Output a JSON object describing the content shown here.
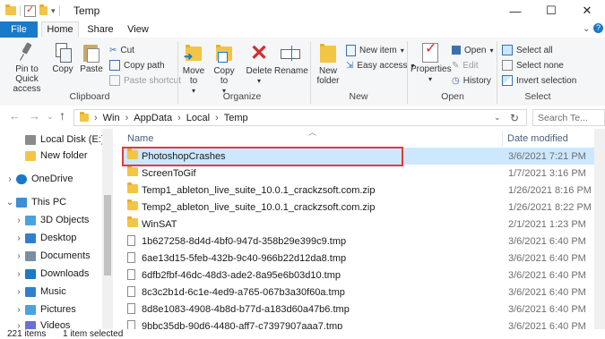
{
  "window": {
    "title": "Temp",
    "minimize": "—",
    "maximize": "☐",
    "close": "✕"
  },
  "tabs": {
    "file": "File",
    "home": "Home",
    "share": "Share",
    "view": "View"
  },
  "ribbon": {
    "clipboard": {
      "pin": "Pin to Quick access",
      "copy": "Copy",
      "paste": "Paste",
      "cut": "Cut",
      "copy_path": "Copy path",
      "paste_shortcut": "Paste shortcut",
      "label": "Clipboard"
    },
    "organize": {
      "move_to": "Move to",
      "copy_to": "Copy to",
      "delete": "Delete",
      "rename": "Rename",
      "label": "Organize"
    },
    "new": {
      "new_folder": "New folder",
      "new_item": "New item",
      "easy_access": "Easy access",
      "label": "New"
    },
    "open": {
      "properties": "Properties",
      "open": "Open",
      "edit": "Edit",
      "history": "History",
      "label": "Open"
    },
    "select": {
      "select_all": "Select all",
      "select_none": "Select none",
      "invert": "Invert selection",
      "label": "Select"
    }
  },
  "address": {
    "path": [
      "Win",
      "AppData",
      "Local",
      "Temp"
    ],
    "search_placeholder": "Search Te..."
  },
  "nav": [
    {
      "label": "Local Disk (E:)",
      "indent": 1,
      "icon": "drive-icon",
      "chevron": ""
    },
    {
      "label": "New folder",
      "indent": 1,
      "icon": "folder-icon",
      "chevron": ""
    },
    {
      "label": "OneDrive",
      "indent": 0,
      "icon": "cloud-icon",
      "chevron": "›"
    },
    {
      "label": "This PC",
      "indent": 0,
      "icon": "pc-icon",
      "chevron": "⌄"
    },
    {
      "label": "3D Objects",
      "indent": 1,
      "icon": "cube-icon",
      "chevron": "›"
    },
    {
      "label": "Desktop",
      "indent": 1,
      "icon": "desktop-icon",
      "chevron": "›"
    },
    {
      "label": "Documents",
      "indent": 1,
      "icon": "documents-icon",
      "chevron": "›"
    },
    {
      "label": "Downloads",
      "indent": 1,
      "icon": "download-icon",
      "chevron": "›"
    },
    {
      "label": "Music",
      "indent": 1,
      "icon": "music-icon",
      "chevron": "›"
    },
    {
      "label": "Pictures",
      "indent": 1,
      "icon": "pictures-icon",
      "chevron": "›"
    },
    {
      "label": "Videos",
      "indent": 1,
      "icon": "videos-icon",
      "chevron": "›"
    }
  ],
  "columns": {
    "name": "Name",
    "date": "Date modified"
  },
  "files": [
    {
      "name": "PhotoshopCrashes",
      "date": "3/6/2021 7:21 PM",
      "type": "folder",
      "selected": true
    },
    {
      "name": "ScreenToGif",
      "date": "1/7/2021 3:16 PM",
      "type": "folder"
    },
    {
      "name": "Temp1_ableton_live_suite_10.0.1_crackzsoft.com.zip",
      "date": "1/26/2021 8:16 PM",
      "type": "folder"
    },
    {
      "name": "Temp2_ableton_live_suite_10.0.1_crackzsoft.com.zip",
      "date": "1/26/2021 8:22 PM",
      "type": "folder"
    },
    {
      "name": "WinSAT",
      "date": "2/1/2021 1:23 PM",
      "type": "folder"
    },
    {
      "name": "1b627258-8d4d-4bf0-947d-358b29e399c9.tmp",
      "date": "3/6/2021 6:40 PM",
      "type": "file"
    },
    {
      "name": "6ae13d15-5feb-432b-9c40-966b22d12da8.tmp",
      "date": "3/6/2021 6:40 PM",
      "type": "file"
    },
    {
      "name": "6dfb2fbf-46dc-48d3-ade2-8a95e6b03d10.tmp",
      "date": "3/6/2021 6:40 PM",
      "type": "file"
    },
    {
      "name": "8c3c2b1d-6c1e-4ed9-a765-067b3a30f60a.tmp",
      "date": "3/6/2021 6:40 PM",
      "type": "file"
    },
    {
      "name": "8d8e1083-4908-4b8d-b77d-a183d60a47b6.tmp",
      "date": "3/6/2021 6:40 PM",
      "type": "file"
    },
    {
      "name": "9bbc35db-90d6-4480-aff7-c7397907aaa7.tmp",
      "date": "3/6/2021 6:40 PM",
      "type": "file"
    }
  ],
  "status": {
    "count": "221 items",
    "selection": "1 item selected"
  },
  "colors": {
    "accent": "#1979ca",
    "selection": "#cce8ff",
    "highlight": "#e03c3c",
    "folder": "#f3c544"
  }
}
